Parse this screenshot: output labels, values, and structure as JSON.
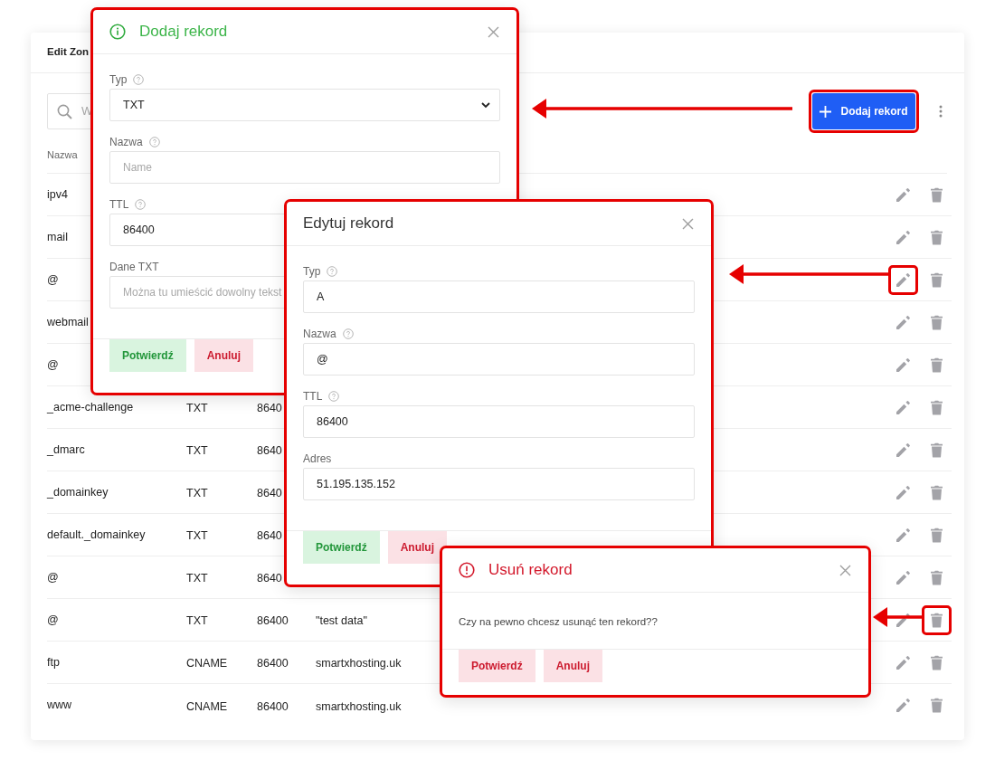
{
  "card": {
    "title": "Edit Zon"
  },
  "search": {
    "placeholder": "W"
  },
  "add_button": {
    "label": "Dodaj rekord",
    "marked": true
  },
  "table": {
    "columns": [
      "Nazwa"
    ],
    "rows": [
      {
        "name": "ipv4",
        "edit_marked": false,
        "delete_marked": false
      },
      {
        "name": "mail",
        "edit_marked": false,
        "delete_marked": false
      },
      {
        "name": "@",
        "edit_marked": true,
        "delete_marked": false
      },
      {
        "name": "webmail",
        "edit_marked": false,
        "delete_marked": false
      },
      {
        "name": "@",
        "edit_marked": false,
        "delete_marked": false
      },
      {
        "name": "_acme-challenge",
        "type": "TXT",
        "ttl": "8640",
        "edit_marked": false,
        "delete_marked": false
      },
      {
        "name": "_dmarc",
        "type": "TXT",
        "ttl": "8640",
        "edit_marked": false,
        "delete_marked": false
      },
      {
        "name": "_domainkey",
        "type": "TXT",
        "ttl": "8640",
        "edit_marked": false,
        "delete_marked": false
      },
      {
        "name": "default._domainkey",
        "type": "TXT",
        "ttl": "8640",
        "edit_marked": false,
        "delete_marked": false
      },
      {
        "name": "@",
        "type": "TXT",
        "ttl": "8640",
        "edit_marked": false,
        "delete_marked": false
      },
      {
        "name": "@",
        "type": "TXT",
        "ttl": "86400",
        "data": "\"test data\"",
        "edit_marked": false,
        "delete_marked": true
      },
      {
        "name": "ftp",
        "type": "CNAME",
        "ttl": "86400",
        "data": "smartxhosting.uk",
        "edit_marked": false,
        "delete_marked": false
      },
      {
        "name": "www",
        "type": "CNAME",
        "ttl": "86400",
        "data": "smartxhosting.uk",
        "edit_marked": false,
        "delete_marked": false
      }
    ]
  },
  "dialogs": [
    {
      "kind": "info",
      "title": "Dodaj rekord",
      "fields": [
        {
          "label": "Typ",
          "help": true,
          "kind": "select",
          "value": "TXT"
        },
        {
          "label": "Nazwa",
          "help": true,
          "kind": "input",
          "placeholder": "Name"
        },
        {
          "label": "TTL",
          "help": true,
          "kind": "input",
          "value": "86400"
        },
        {
          "label": "Dane TXT",
          "help": false,
          "kind": "input",
          "placeholder": "Można tu umieścić dowolny tekst"
        }
      ],
      "buttons": [
        {
          "label": "Potwierdź",
          "kind": "success"
        },
        {
          "label": "Anuluj",
          "kind": "danger"
        }
      ]
    },
    {
      "kind": "plain",
      "title": "Edytuj rekord",
      "fields": [
        {
          "label": "Typ",
          "help": true,
          "kind": "input",
          "value": "A"
        },
        {
          "label": "Nazwa",
          "help": true,
          "kind": "input",
          "value": "@"
        },
        {
          "label": "TTL",
          "help": true,
          "kind": "input",
          "value": "86400"
        },
        {
          "label": "Adres",
          "help": false,
          "kind": "input",
          "value": "51.195.135.152"
        }
      ],
      "buttons": [
        {
          "label": "Potwierdź",
          "kind": "success"
        },
        {
          "label": "Anuluj",
          "kind": "danger"
        }
      ]
    },
    {
      "kind": "danger",
      "title": "Usuń rekord",
      "message": "Czy na pewno chcesz usunąć ten rekord??",
      "buttons": [
        {
          "label": "Potwierdź",
          "kind": "danger"
        },
        {
          "label": "Anuluj",
          "kind": "danger"
        }
      ]
    }
  ]
}
